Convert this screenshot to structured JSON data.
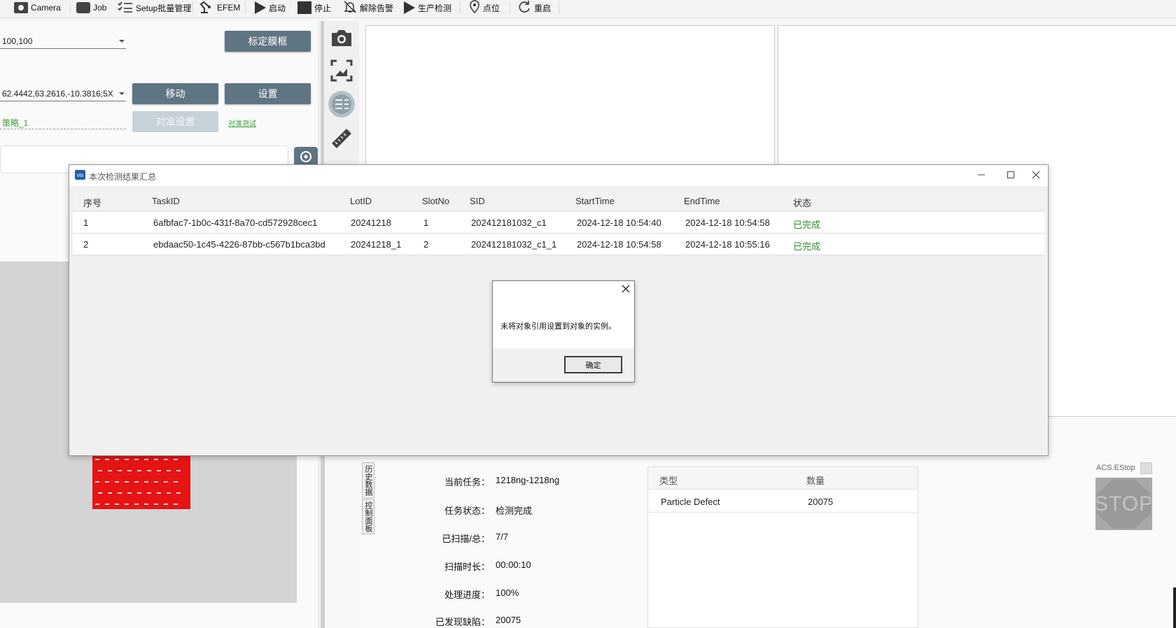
{
  "toolbar": {
    "items": [
      {
        "label": "Camera",
        "icon": "camera-icon"
      },
      {
        "label": "Job",
        "icon": "job-icon"
      },
      {
        "label": "Setup批量管理",
        "icon": "checklist-icon"
      },
      {
        "label": "EFEM",
        "icon": "robot-arm-icon"
      },
      {
        "label": "启动",
        "icon": "play-icon"
      },
      {
        "label": "停止",
        "icon": "stop-icon"
      },
      {
        "label": "解除告警",
        "icon": "bell-off-icon"
      },
      {
        "label": "生产检测",
        "icon": "play-icon"
      },
      {
        "label": "点位",
        "icon": "location-pin-icon"
      },
      {
        "label": "重启",
        "icon": "restart-icon"
      }
    ]
  },
  "left_panel": {
    "size_select": "100,100",
    "calibrate_button": "标定膜框",
    "position_select": "62.4442,63.2616,-10.3816;5X",
    "move_button": "移动",
    "set_button": "设置",
    "strategy_select": "策略_1",
    "align_settings_button": "对准设置",
    "align_test_link": "对准测试"
  },
  "stats": {
    "current_task_label": "当前任务：",
    "current_task_value": "1218ng-1218ng",
    "task_status_label": "任务状态：",
    "task_status_value": "检测完成",
    "scanned_label": "已扫描/总：",
    "scanned_value": "7/7",
    "scan_time_label": "扫描时长：",
    "scan_time_value": "00:00:10",
    "progress_label": "处理进度：",
    "progress_value": "100%",
    "defects_label": "已发现缺陷：",
    "defects_value": "20075",
    "tab_history": "历史数据",
    "tab_control": "控制面板"
  },
  "defect_table": {
    "headers": [
      "类型",
      "数量"
    ],
    "rows": [
      [
        "Particle Defect",
        "20075"
      ]
    ]
  },
  "estop": {
    "label": "ACS.EStop",
    "sign": "STOP"
  },
  "summary_window": {
    "title": "本次检测结果汇总",
    "app_icon_text": "vis",
    "headers": [
      "序号",
      "TaskID",
      "LotID",
      "SlotNo",
      "SID",
      "StartTime",
      "EndTime",
      "状态"
    ],
    "rows": [
      [
        "1",
        "6afbfac7-1b0c-431f-8a70-cd572928cec1",
        "20241218",
        "1",
        "202412181032_c1",
        "2024-12-18 10:54:40",
        "2024-12-18 10:54:58",
        "已完成"
      ],
      [
        "2",
        "ebdaac50-1c45-4226-87bb-c567b1bca3bd",
        "20241218_1",
        "2",
        "202412181032_c1_1",
        "2024-12-18 10:54:58",
        "2024-12-18 10:55:16",
        "已完成"
      ]
    ]
  },
  "message_box": {
    "message": "未将对象引用设置到对象的实例。",
    "ok_button": "确定"
  }
}
